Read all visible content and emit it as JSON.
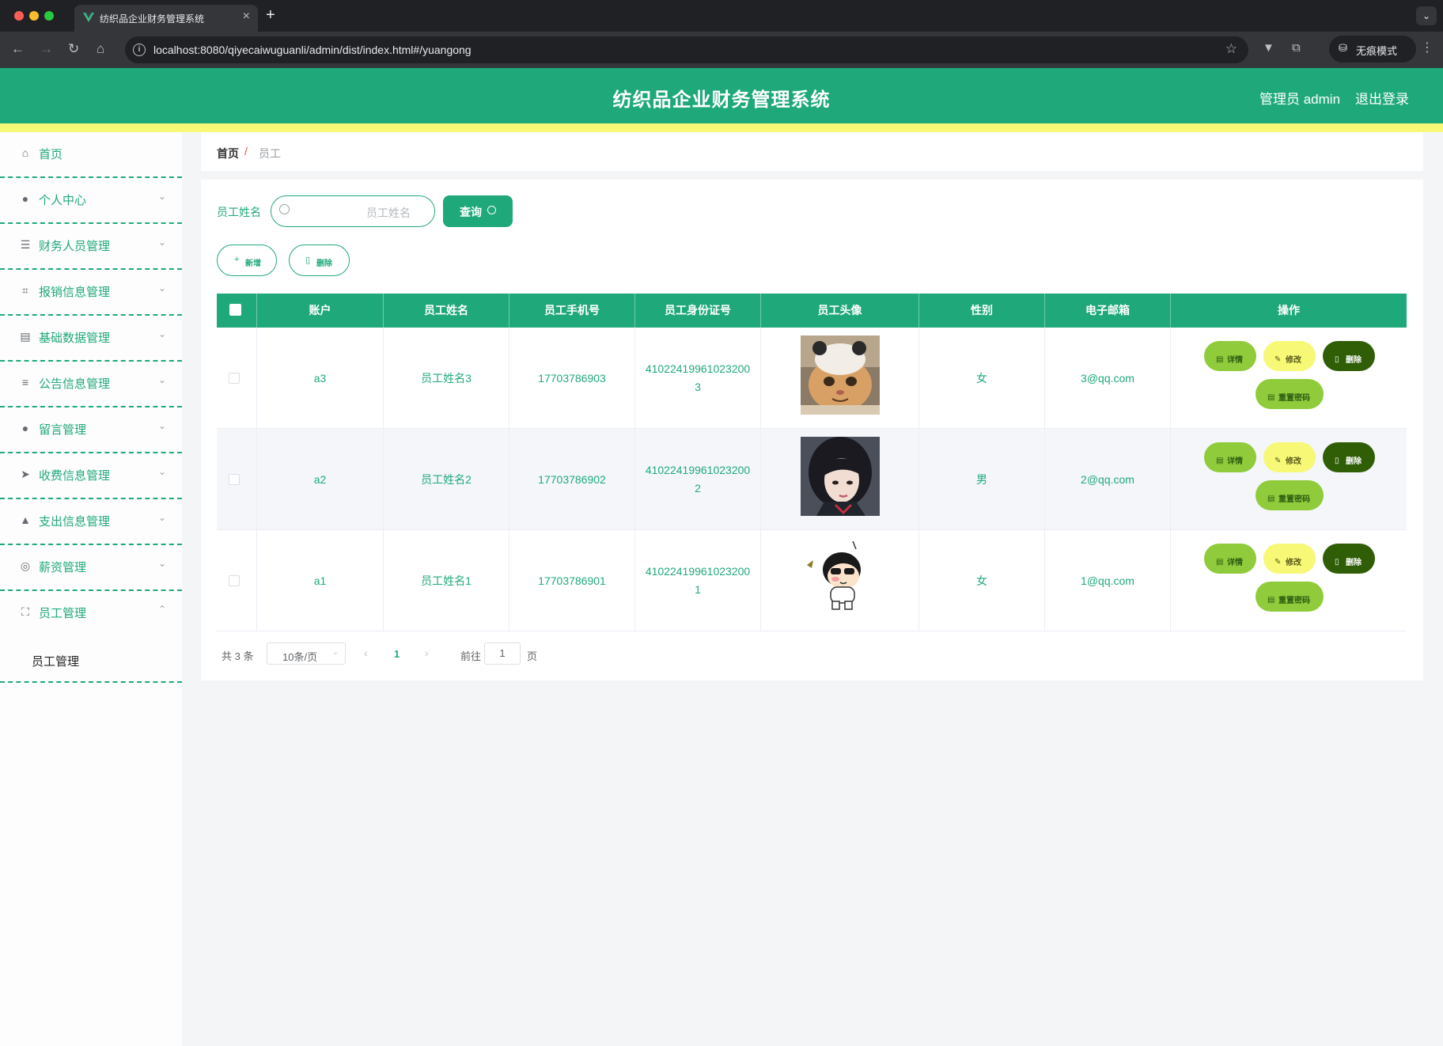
{
  "browser": {
    "tab_title": "纺织品企业财务管理系统",
    "url": "localhost:8080/qiyecaiwuguanli/admin/dist/index.html#/yuangong",
    "incognito_label": "无痕模式"
  },
  "header": {
    "title": "纺织品企业财务管理系统",
    "admin_label": "管理员 admin",
    "logout_label": "退出登录"
  },
  "sidebar": {
    "items": [
      {
        "label": "首页",
        "icon": "home-icon"
      },
      {
        "label": "个人中心",
        "icon": "user-icon"
      },
      {
        "label": "财务人员管理",
        "icon": "sliders-icon"
      },
      {
        "label": "报销信息管理",
        "icon": "crop-icon"
      },
      {
        "label": "基础数据管理",
        "icon": "clipboard-icon"
      },
      {
        "label": "公告信息管理",
        "icon": "list-icon"
      },
      {
        "label": "留言管理",
        "icon": "user-icon"
      },
      {
        "label": "收费信息管理",
        "icon": "send-icon"
      },
      {
        "label": "支出信息管理",
        "icon": "user-upload-icon"
      },
      {
        "label": "薪资管理",
        "icon": "compass-icon"
      },
      {
        "label": "员工管理",
        "icon": "fullscreen-icon"
      }
    ],
    "submenu": "员工管理"
  },
  "breadcrumb": {
    "home": "首页",
    "separator": "/",
    "current": "员工"
  },
  "search": {
    "label": "员工姓名",
    "placeholder": "员工姓名",
    "query_label": "查询"
  },
  "actions": {
    "add_label": "新增",
    "delete_label": "删除"
  },
  "table": {
    "columns": [
      "账户",
      "员工姓名",
      "员工手机号",
      "员工身份证号",
      "员工头像",
      "性别",
      "电子邮箱",
      "操作"
    ],
    "rows": [
      {
        "account": "a3",
        "name": "员工姓名3",
        "phone": "17703786903",
        "id_line1": "41022419961023200",
        "id_line2": "3",
        "avatar": "cat-photo",
        "gender": "女",
        "email": "3@qq.com"
      },
      {
        "account": "a2",
        "name": "员工姓名2",
        "phone": "17703786902",
        "id_line1": "41022419961023200",
        "id_line2": "2",
        "avatar": "girl-photo",
        "gender": "男",
        "email": "2@qq.com"
      },
      {
        "account": "a1",
        "name": "员工姓名1",
        "phone": "17703786901",
        "id_line1": "41022419961023200",
        "id_line2": "1",
        "avatar": "cartoon-boy",
        "gender": "女",
        "email": "1@qq.com"
      }
    ],
    "row_actions": {
      "detail": "详情",
      "edit": "修改",
      "delete": "删除",
      "reset": "重置密码"
    }
  },
  "pagination": {
    "total": "共 3 条",
    "page_size": "10条/页",
    "current_page": "1",
    "goto_label": "前往",
    "goto_value": "1",
    "page_suffix": "页"
  },
  "colors": {
    "primary": "#1fa97a",
    "accent_yellow": "#f6f876",
    "detail_green": "#8fcb3a",
    "delete_dark": "#2f5e07"
  }
}
